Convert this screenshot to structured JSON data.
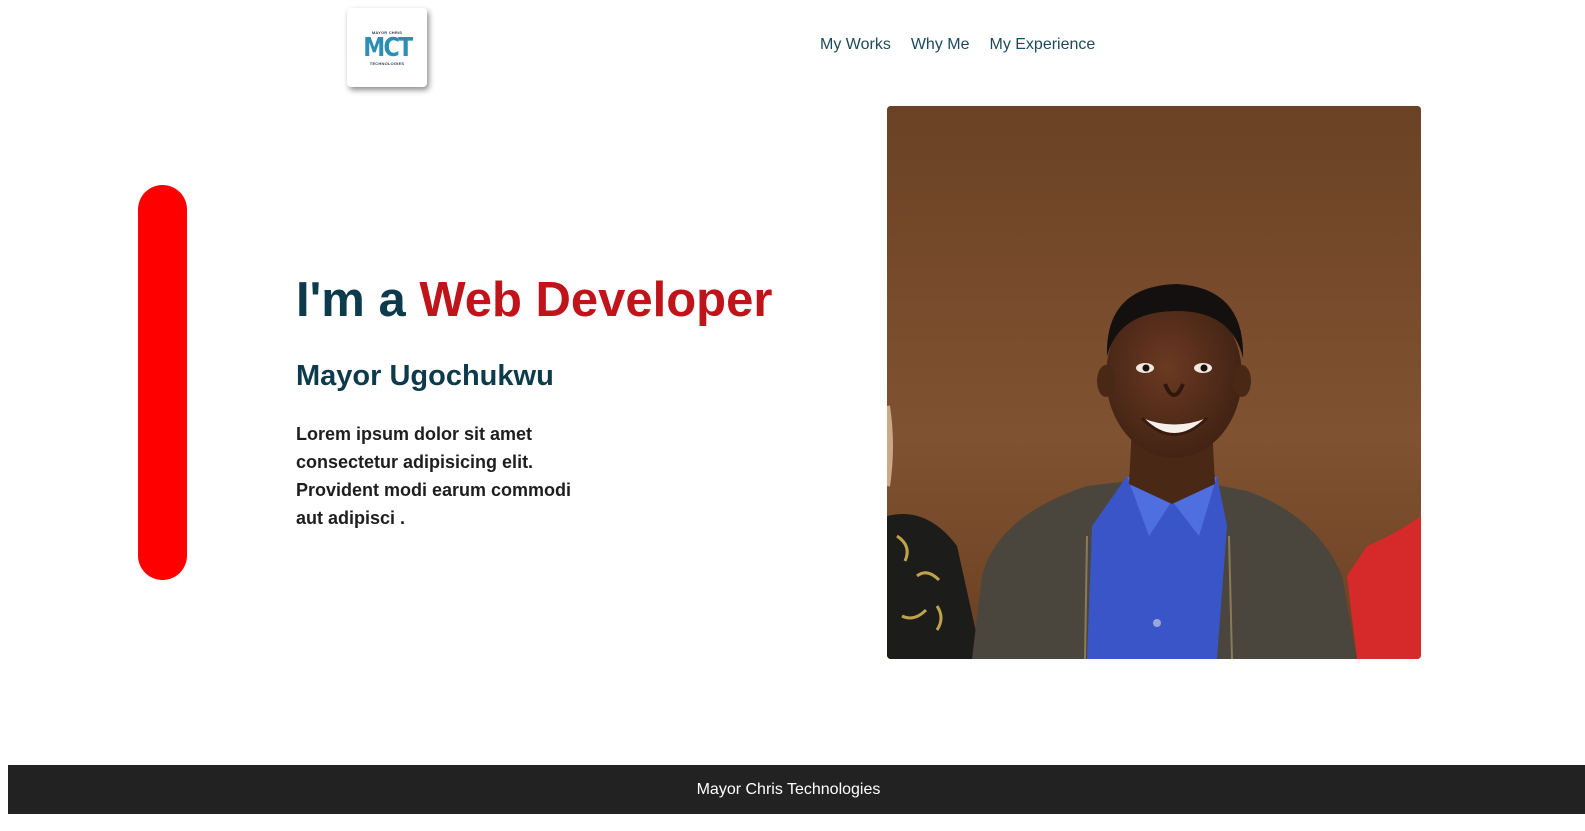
{
  "brand": {
    "logo_top": "MAYOR CHRIS",
    "logo_mark": "MCT",
    "logo_bottom": "TECHNOLOGIES"
  },
  "nav": {
    "items": [
      {
        "label": "My Works"
      },
      {
        "label": "Why Me"
      },
      {
        "label": "My Experience"
      }
    ]
  },
  "hero": {
    "title_prefix": "I'm a ",
    "title_accent": "Web Developer",
    "name": "Mayor Ugochukwu",
    "description": "Lorem ipsum dolor sit amet consectetur adipisicing elit. Provident modi earum commodi aut adipisci ."
  },
  "footer": {
    "text": "Mayor Chris Technologies"
  },
  "colors": {
    "accent_red": "#c0141a",
    "bar_red": "#ff0000",
    "heading_navy": "#0d3b4c",
    "footer_bg": "#222222"
  }
}
